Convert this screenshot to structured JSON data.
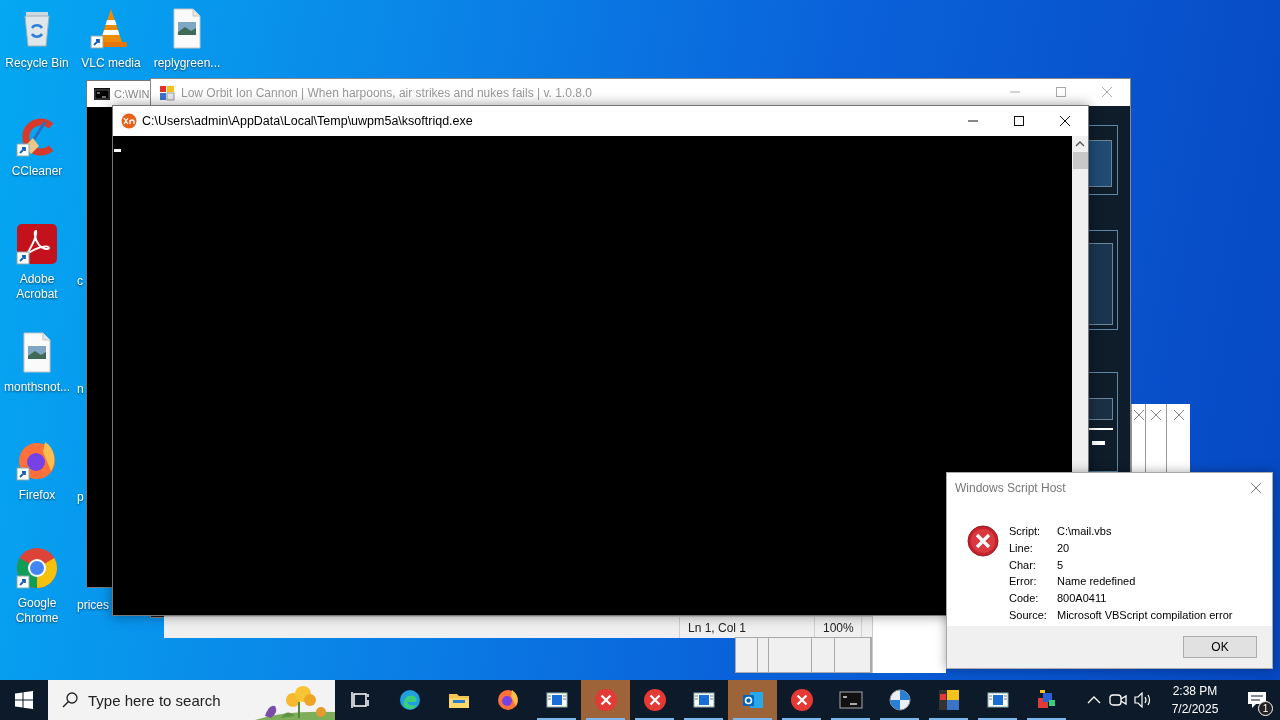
{
  "desktop_icons": [
    {
      "label": "Recycle Bin",
      "kind": "recycle",
      "shortcut": false
    },
    {
      "label": "VLC media",
      "kind": "vlc",
      "shortcut": true
    },
    {
      "label": "replygreen...",
      "kind": "image-file",
      "shortcut": false
    },
    {
      "label": "CCleaner",
      "kind": "ccleaner",
      "shortcut": true
    },
    {
      "label": "Adobe Acrobat",
      "kind": "acrobat",
      "shortcut": true
    },
    {
      "label": "monthsnot...",
      "kind": "image-file",
      "shortcut": false
    },
    {
      "label": "Firefox",
      "kind": "firefox",
      "shortcut": true
    },
    {
      "label": "Google Chrome",
      "kind": "chrome",
      "shortcut": true
    }
  ],
  "hidden_icon_labels": [
    "c",
    "n",
    "p",
    "prices"
  ],
  "cmd_window": {
    "title": "C:\\WIN",
    "active": false
  },
  "loic_window": {
    "title": "Low Orbit Ion Cannon | When harpoons, air strikes and nukes fails | v. 1.0.8.0",
    "active": false
  },
  "console_window": {
    "title": "C:\\Users\\admin\\AppData\\Local\\Temp\\uwpm5a\\ksoftriqd.exe",
    "active": true
  },
  "notepad_status_bar": [
    "Ln 1, Col 1",
    "100%"
  ],
  "dialog": {
    "title": "Windows Script Host",
    "active": false,
    "fields": [
      {
        "label": "Script:",
        "value": "C:\\mail.vbs"
      },
      {
        "label": "Line:",
        "value": "20"
      },
      {
        "label": "Char:",
        "value": "5"
      },
      {
        "label": "Error:",
        "value": "Name redefined"
      },
      {
        "label": "Code:",
        "value": "800A0411"
      },
      {
        "label": "Source:",
        "value": "Microsoft VBScript compilation error"
      }
    ],
    "button": "OK"
  },
  "taskbar": {
    "search_placeholder": "Type here to search",
    "apps": [
      {
        "kind": "task-view",
        "running": false,
        "highlighted": false
      },
      {
        "kind": "edge",
        "running": false,
        "highlighted": false
      },
      {
        "kind": "explorer",
        "running": false,
        "highlighted": false
      },
      {
        "kind": "firefox",
        "running": false,
        "highlighted": false
      },
      {
        "kind": "window",
        "running": true,
        "highlighted": false
      },
      {
        "kind": "error",
        "running": true,
        "highlighted": true
      },
      {
        "kind": "error",
        "running": true,
        "highlighted": false
      },
      {
        "kind": "window",
        "running": true,
        "highlighted": false
      },
      {
        "kind": "outlook",
        "running": true,
        "highlighted": true
      },
      {
        "kind": "error",
        "running": true,
        "highlighted": false
      },
      {
        "kind": "console",
        "running": true,
        "highlighted": false
      },
      {
        "kind": "globe",
        "running": true,
        "highlighted": false
      },
      {
        "kind": "palette",
        "running": true,
        "highlighted": false
      },
      {
        "kind": "window",
        "running": true,
        "highlighted": false
      },
      {
        "kind": "cubes",
        "running": true,
        "highlighted": false
      }
    ],
    "time": "2:38 PM",
    "date": "7/2/2025",
    "notification_count": "1"
  }
}
